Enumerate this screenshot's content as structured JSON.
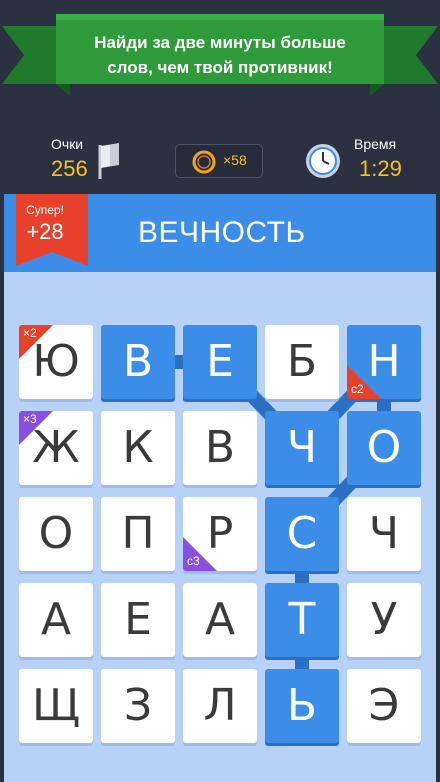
{
  "banner": {
    "message": "Найди за две минуты больше слов, чем твой противник!"
  },
  "stats": {
    "score_label": "Очки",
    "score_value": "256",
    "coins_value": "×58",
    "time_label": "Время",
    "time_value": "1:29"
  },
  "current_word": "ВЕЧНОСТЬ",
  "bonus": {
    "label": "Супер!",
    "value": "+28"
  },
  "colors": {
    "accent_blue": "#3b8de8",
    "gold": "#f5c31d",
    "banner_green": "#2e9a3a",
    "bonus_red": "#e8412b",
    "purple": "#8a4fe0"
  },
  "board": {
    "rows": [
      [
        "Ю",
        "В",
        "Е",
        "Б",
        "Н"
      ],
      [
        "Ж",
        "К",
        "В",
        "Ч",
        "О"
      ],
      [
        "О",
        "П",
        "Р",
        "С",
        "Ч"
      ],
      [
        "А",
        "Е",
        "А",
        "Т",
        "У"
      ],
      [
        "Щ",
        "З",
        "Л",
        "Ь",
        "Э"
      ]
    ],
    "selected_path": [
      [
        0,
        1
      ],
      [
        0,
        2
      ],
      [
        1,
        3
      ],
      [
        0,
        4
      ],
      [
        1,
        4
      ],
      [
        2,
        3
      ],
      [
        3,
        3
      ],
      [
        4,
        3
      ]
    ],
    "multipliers": [
      {
        "cell": [
          0,
          0
        ],
        "text": "×2",
        "color": "red",
        "corner": "top-left"
      },
      {
        "cell": [
          1,
          0
        ],
        "text": "×3",
        "color": "purple",
        "corner": "top-left"
      },
      {
        "cell": [
          0,
          4
        ],
        "text": "c2",
        "color": "red",
        "corner": "bottom-left"
      },
      {
        "cell": [
          2,
          2
        ],
        "text": "c3",
        "color": "purple",
        "corner": "bottom-left"
      }
    ]
  }
}
